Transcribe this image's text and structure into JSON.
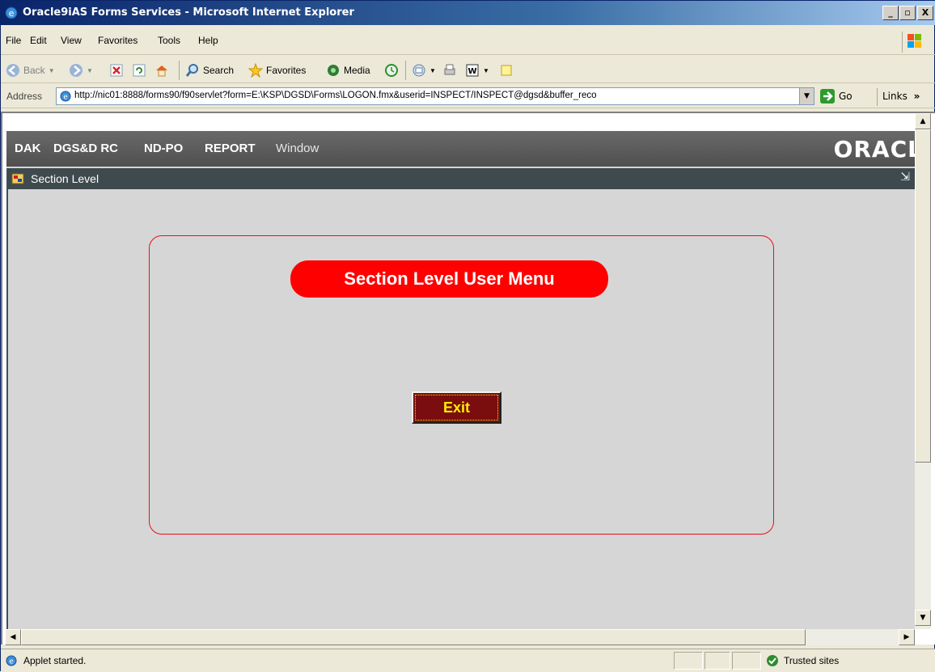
{
  "window": {
    "title": "Oracle9iAS Forms Services - Microsoft Internet Explorer",
    "min_label": "_",
    "max_label": "▫",
    "close_label": "X"
  },
  "menubar": {
    "items": [
      "File",
      "Edit",
      "View",
      "Favorites",
      "Tools",
      "Help"
    ]
  },
  "toolbar": {
    "back_label": "Back",
    "search_label": "Search",
    "favorites_label": "Favorites",
    "media_label": "Media"
  },
  "address": {
    "label": "Address",
    "url": "http://nic01:8888/forms90/f90servlet?form=E:\\KSP\\DGSD\\Forms\\LOGON.fmx&userid=INSPECT/INSPECT@dgsd&buffer_reco",
    "go_label": "Go",
    "links_label": "Links"
  },
  "oracle_menu": {
    "items": [
      "DAK",
      "DGS&D RC",
      "ND-PO",
      "REPORT"
    ],
    "window_label": "Window",
    "logo_text": "ORACL"
  },
  "inner_window": {
    "title": "Section Level"
  },
  "form": {
    "menu_title": "Section Level User Menu",
    "exit_label": "Exit"
  },
  "statusbar": {
    "status_text": "Applet started.",
    "zone_text": "Trusted sites"
  },
  "colors": {
    "menu_title_bg": "#ff0000",
    "frame_border": "#e8101a",
    "exit_bg": "#7a0e0e",
    "exit_text": "#ffef00",
    "oracle_bar": "#5a5a5a",
    "inner_title_bar": "#3e4a4e"
  }
}
